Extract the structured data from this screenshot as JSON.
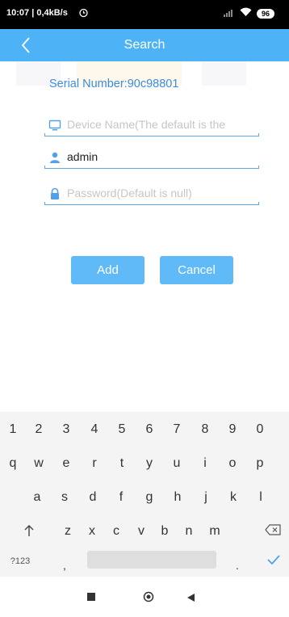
{
  "status_bar": {
    "time_speed": "10:07 | 0,4kB/s",
    "battery": "96"
  },
  "header": {
    "title": "Search"
  },
  "form": {
    "serial_label": "Serial Number:90c98801",
    "device_name_placeholder": "Device Name(The default is the",
    "username_value": "admin",
    "password_placeholder": "Password(Default is null)"
  },
  "buttons": {
    "add": "Add",
    "cancel": "Cancel"
  },
  "keyboard": {
    "numbers": [
      "1",
      "2",
      "3",
      "4",
      "5",
      "6",
      "7",
      "8",
      "9",
      "0"
    ],
    "row1": [
      "q",
      "w",
      "e",
      "r",
      "t",
      "y",
      "u",
      "i",
      "o",
      "p"
    ],
    "row2": [
      "a",
      "s",
      "d",
      "f",
      "g",
      "h",
      "j",
      "k",
      "l"
    ],
    "row3": [
      "z",
      "x",
      "c",
      "v",
      "b",
      "n",
      "m"
    ],
    "symbols_key": "?123",
    "comma_key": ",",
    "period_key": "."
  },
  "colors": {
    "accent": "#4eb2f7",
    "serial_text": "#3a8de0",
    "button": "#5fbaf7"
  }
}
